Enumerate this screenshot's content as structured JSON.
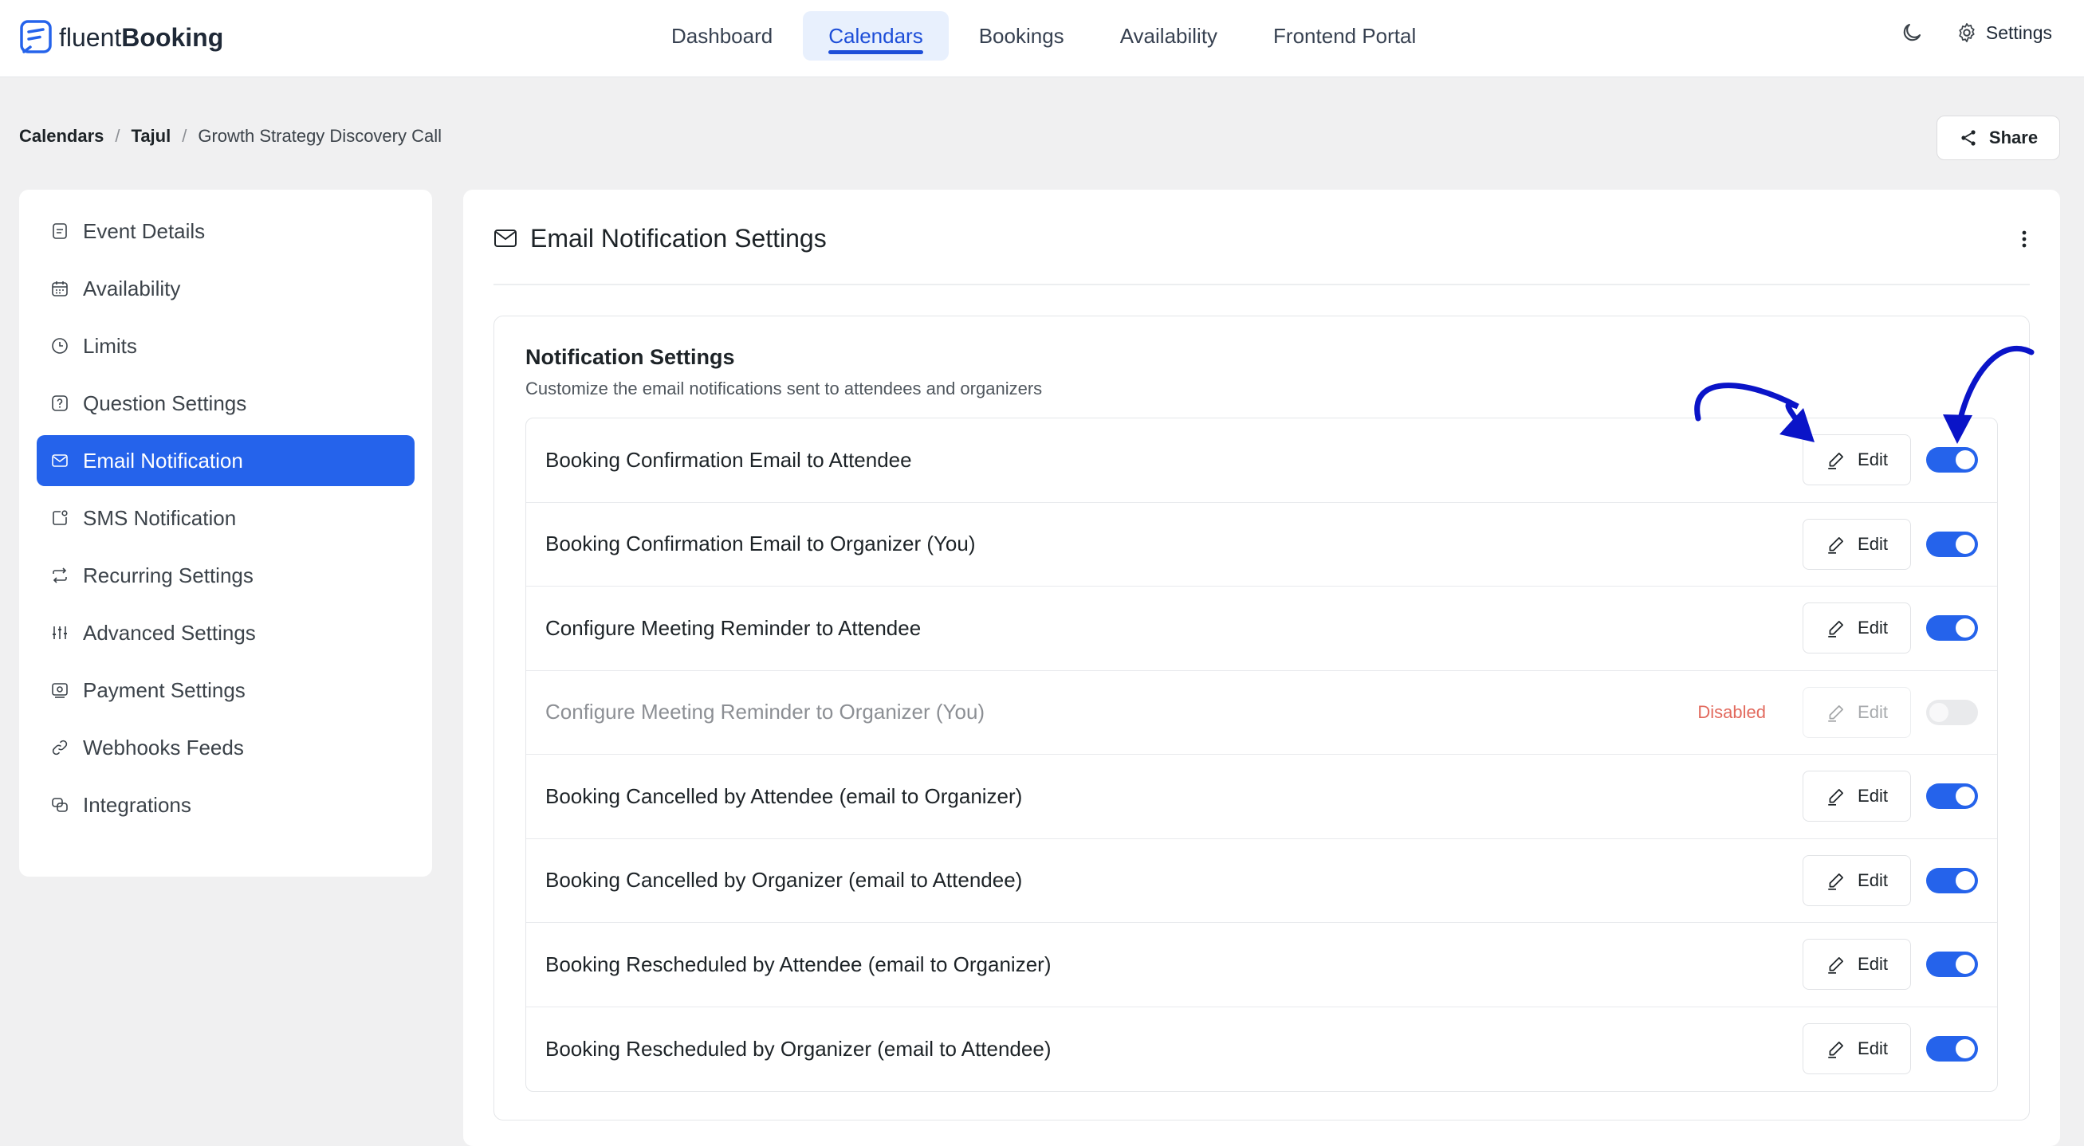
{
  "app": {
    "logo_light": "fluent",
    "logo_bold": "Booking"
  },
  "nav": {
    "items": [
      {
        "label": "Dashboard",
        "active": false
      },
      {
        "label": "Calendars",
        "active": true
      },
      {
        "label": "Bookings",
        "active": false
      },
      {
        "label": "Availability",
        "active": false
      },
      {
        "label": "Frontend Portal",
        "active": false
      }
    ],
    "settings_label": "Settings",
    "theme_icon": "moon-icon"
  },
  "breadcrumb": {
    "root": "Calendars",
    "sep": "/",
    "owner": "Tajul",
    "event": "Growth Strategy Discovery Call"
  },
  "share_label": "Share",
  "sidebar": {
    "items": [
      {
        "label": "Event Details",
        "icon": "document-icon"
      },
      {
        "label": "Availability",
        "icon": "calendar-icon"
      },
      {
        "label": "Limits",
        "icon": "clock-icon"
      },
      {
        "label": "Question Settings",
        "icon": "question-icon"
      },
      {
        "label": "Email Notification",
        "icon": "mail-icon",
        "active": true
      },
      {
        "label": "SMS Notification",
        "icon": "sms-icon"
      },
      {
        "label": "Recurring Settings",
        "icon": "repeat-icon"
      },
      {
        "label": "Advanced Settings",
        "icon": "sliders-icon"
      },
      {
        "label": "Payment Settings",
        "icon": "payment-icon"
      },
      {
        "label": "Webhooks Feeds",
        "icon": "link-icon"
      },
      {
        "label": "Integrations",
        "icon": "integration-icon"
      }
    ]
  },
  "panel": {
    "title": "Email Notification Settings",
    "card_title": "Notification Settings",
    "card_subtitle": "Customize the email notifications sent to attendees and organizers",
    "edit_label": "Edit",
    "disabled_label": "Disabled",
    "notifications": [
      {
        "label": "Booking Confirmation Email to Attendee",
        "enabled": true
      },
      {
        "label": "Booking Confirmation Email to Organizer (You)",
        "enabled": true
      },
      {
        "label": "Configure Meeting Reminder to Attendee",
        "enabled": true
      },
      {
        "label": "Configure Meeting Reminder to Organizer (You)",
        "enabled": false
      },
      {
        "label": "Booking Cancelled by Attendee (email to Organizer)",
        "enabled": true
      },
      {
        "label": "Booking Cancelled by Organizer (email to Attendee)",
        "enabled": true
      },
      {
        "label": "Booking Rescheduled by Attendee (email to Organizer)",
        "enabled": true
      },
      {
        "label": "Booking Rescheduled by Organizer (email to Attendee)",
        "enabled": true
      }
    ]
  },
  "colors": {
    "accent": "#2563eb",
    "disabled_text": "#e26a5e",
    "annotation": "#0a14c8"
  }
}
